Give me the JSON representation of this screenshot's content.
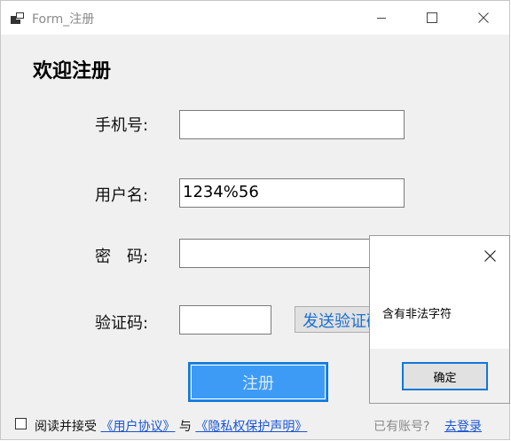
{
  "window": {
    "title": "Form_注册",
    "icon": "app-window-icon",
    "controls": [
      "minimize-icon",
      "maximize-icon",
      "close-icon"
    ]
  },
  "form": {
    "heading": "欢迎注册",
    "phone": {
      "label": "手机号:",
      "value": ""
    },
    "username": {
      "label": "用户名:",
      "value": "1234%56"
    },
    "password": {
      "label": "密　码:",
      "value": ""
    },
    "code": {
      "label": "验证码:",
      "value": "",
      "send_label": "发送验证码"
    },
    "register_label": "注册",
    "agree": {
      "checked": false,
      "prefix": "阅读并接受",
      "link1": "《用户协议》",
      "middle": "与",
      "link2": "《隐私权保护声明》"
    },
    "login_prompt": "已有账号?",
    "login_link": "去登录"
  },
  "dialog": {
    "message": "含有非法字符",
    "ok_label": "确定",
    "close_icon": "close-icon"
  },
  "colors": {
    "accent": "#3d9bf5",
    "link": "#1a55d6",
    "background": "#f0f0f0"
  }
}
